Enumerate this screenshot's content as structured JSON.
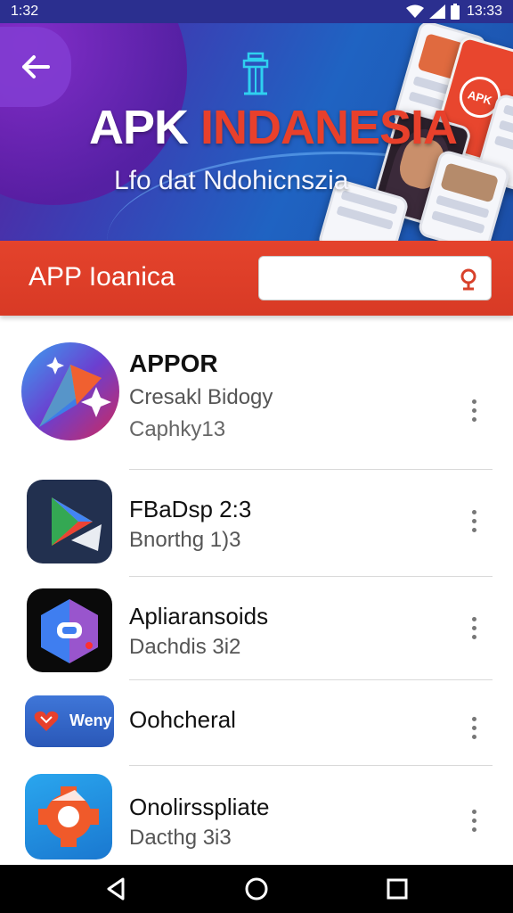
{
  "status": {
    "time": "1:32",
    "clock": "13:33"
  },
  "banner": {
    "title_part1": "APK ",
    "title_part2": "INDANESIA",
    "subtitle": "Lfo dat Ndohicnszia",
    "badge_text": "APK"
  },
  "appbar": {
    "title": "APP Ioanica",
    "search_value": ""
  },
  "apps": [
    {
      "title": "APPOR",
      "line1": "Cresakl Bidogy",
      "line2": "Caphky13"
    },
    {
      "title": "FBaDsp 2:3",
      "line1": "Bnorthg 1)3"
    },
    {
      "title": "Apliaransoids",
      "line1": "Dachdis 3i2"
    },
    {
      "title": "Oohcheral",
      "icon_label": "Weny"
    },
    {
      "title": "Onolirsspliate",
      "line1": "Dacthg 3i3"
    }
  ],
  "colors": {
    "appbar_red": "#e4432c",
    "banner_blue": "#1f63c2",
    "banner_purple": "#5b1f9e",
    "title_red": "#e8402b"
  },
  "icons": {
    "back": "arrow-left-icon",
    "search": "search-icon",
    "more": "more-vertical-icon",
    "nav_back": "triangle-back-icon",
    "nav_home": "circle-home-icon",
    "nav_recents": "square-recents-icon"
  }
}
